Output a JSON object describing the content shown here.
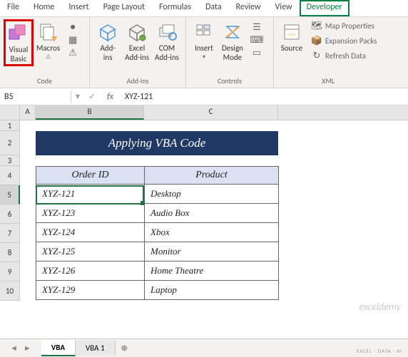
{
  "menu": {
    "items": [
      "File",
      "Home",
      "Insert",
      "Page Layout",
      "Formulas",
      "Data",
      "Review",
      "View",
      "Developer"
    ]
  },
  "ribbon": {
    "visual_basic": "Visual\nBasic",
    "macros": "Macros",
    "addins": "Add-\nins",
    "excel_addins": "Excel\nAdd-ins",
    "com_addins": "COM\nAdd-ins",
    "insert": "Insert",
    "design_mode": "Design\nMode",
    "source": "Source",
    "map_props": "Map Properties",
    "expansion": "Expansion Packs",
    "refresh": "Refresh Data",
    "groups": {
      "code": "Code",
      "addins": "Add-ins",
      "controls": "Controls",
      "xml": "XML"
    }
  },
  "cell_ref": "B5",
  "formula": "XYZ-121",
  "columns": [
    "A",
    "B",
    "C"
  ],
  "rows": [
    "1",
    "2",
    "3",
    "4",
    "5",
    "6",
    "7",
    "8",
    "9",
    "10"
  ],
  "title": "Applying VBA Code",
  "headers": {
    "order": "Order ID",
    "product": "Product"
  },
  "data": [
    {
      "order": "XYZ-121",
      "product": "Desktop"
    },
    {
      "order": "XYZ-123",
      "product": "Audio Box"
    },
    {
      "order": "XYZ-124",
      "product": "Xbox"
    },
    {
      "order": "XYZ-125",
      "product": "Monitor"
    },
    {
      "order": "XYZ-126",
      "product": "Home Theatre"
    },
    {
      "order": "XYZ-129",
      "product": "Laptop"
    }
  ],
  "watermark": "exceldemy",
  "sheets": {
    "active": "VBA",
    "other": "VBA 1"
  },
  "status": "EXCEL · DATA · BI"
}
